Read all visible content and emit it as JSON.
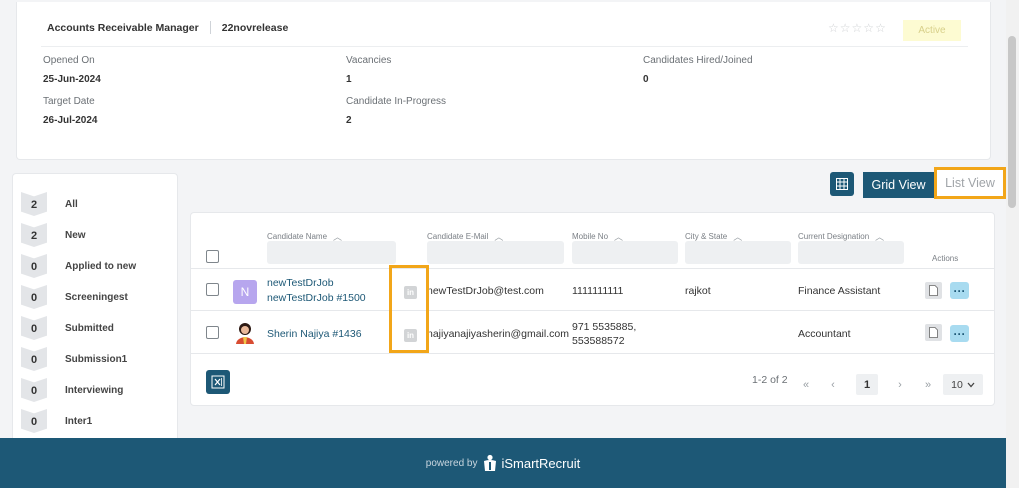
{
  "job": {
    "title": "Accounts Receivable Manager",
    "release": "22novrelease",
    "status": "Active",
    "opened_on_label": "Opened On",
    "opened_on": "25-Jun-2024",
    "target_date_label": "Target Date",
    "target_date": "26-Jul-2024",
    "vacancies_label": "Vacancies",
    "vacancies": "1",
    "in_progress_label": "Candidate In-Progress",
    "in_progress": "2",
    "hired_label": "Candidates Hired/Joined",
    "hired": "0",
    "rating_stars": 0
  },
  "stages": [
    {
      "count": "2",
      "label": "All"
    },
    {
      "count": "2",
      "label": "New"
    },
    {
      "count": "0",
      "label": "Applied to new"
    },
    {
      "count": "0",
      "label": "Screeningest"
    },
    {
      "count": "0",
      "label": "Submitted"
    },
    {
      "count": "0",
      "label": "Submission1"
    },
    {
      "count": "0",
      "label": "Interviewing"
    },
    {
      "count": "0",
      "label": "Inter1"
    }
  ],
  "views": {
    "grid": "Grid View",
    "list": "List View"
  },
  "table": {
    "columns": {
      "name": "Candidate Name",
      "email": "Candidate E-Mail",
      "mobile": "Mobile No",
      "city": "City & State",
      "designation": "Current Designation",
      "actions": "Actions"
    },
    "rows": [
      {
        "avatar_letter": "N",
        "name_line1": "newTestDrJob",
        "name_line2": "newTestDrJob #1500",
        "linkedin": "in",
        "email": "newTestDrJob@test.com",
        "mobile_line1": "1111111111",
        "mobile_line2": "",
        "city": "rajkot",
        "designation": "Finance Assistant"
      },
      {
        "avatar_letter": "",
        "name_line1": "Sherin Najiya #1436",
        "name_line2": "",
        "linkedin": "in",
        "email": "najiyanajiyasherin@gmail.com",
        "mobile_line1": "971 5535885,",
        "mobile_line2": "553588572",
        "city": "",
        "designation": "Accountant"
      }
    ]
  },
  "pagination": {
    "range": "1-2 of 2",
    "first": "«",
    "prev": "‹",
    "page": "1",
    "next": "›",
    "last": "»",
    "page_size": "10"
  },
  "footer": {
    "powered_by": "powered by",
    "brand": "iSmartRecruit"
  },
  "colors": {
    "primary": "#1d5876",
    "highlight": "#f2a619",
    "status_bg": "#fdfbd2"
  }
}
